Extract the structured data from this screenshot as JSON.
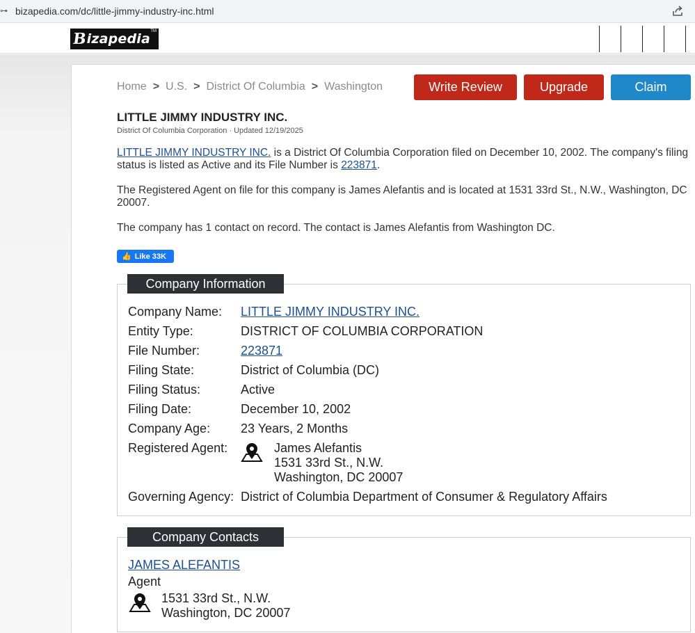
{
  "browser": {
    "url": "bizapedia.com/dc/little-jimmy-industry-inc.html",
    "site_icon": "⊶",
    "share_icon": "share-icon"
  },
  "header": {
    "logo_text": "Bizapedia",
    "logo_mark": "B",
    "logo_rest": "izapedia",
    "logo_tm": "TM"
  },
  "breadcrumb": {
    "items": [
      "Home",
      "U.S.",
      "District Of Columbia",
      "Washington"
    ],
    "separator": ">"
  },
  "actions": {
    "write_review": "Write Review",
    "upgrade": "Upgrade",
    "claim": "Claim"
  },
  "company": {
    "name": "LITTLE JIMMY INDUSTRY INC.",
    "subtitle": "District Of Columbia Corporation · Updated 12/19/2025"
  },
  "summary": {
    "p1_link": "LITTLE JIMMY INDUSTRY INC.",
    "p1_text": " is a District Of Columbia Corporation filed on December 10, 2002. The company's filing status is listed as Active and its File Number is ",
    "p1_file_link": "223871",
    "p1_end": ".",
    "p2": "The Registered Agent on file for this company is James Alefantis and is located at 1531 33rd St., N.W., Washington, DC 20007.",
    "p3": "The company has 1 contact on record. The contact is James Alefantis from Washington DC."
  },
  "like_button": {
    "label": "Like 33K",
    "icon": "👍"
  },
  "company_info": {
    "heading": "Company Information",
    "rows": [
      {
        "label": "Company Name:",
        "value": "LITTLE JIMMY INDUSTRY INC."
      },
      {
        "label": "Entity Type:",
        "value": "DISTRICT OF COLUMBIA CORPORATION"
      },
      {
        "label": "File Number:",
        "value": "223871"
      },
      {
        "label": "Filing State:",
        "value": "District of Columbia (DC)"
      },
      {
        "label": "Filing Status:",
        "value": "Active"
      },
      {
        "label": "Filing Date:",
        "value": "December 10, 2002"
      },
      {
        "label": "Company Age:",
        "value": "23 Years, 2 Months"
      },
      {
        "label": "Registered Agent:",
        "value_lines": [
          "James Alefantis",
          "1531 33rd St., N.W.",
          "Washington, DC 20007"
        ]
      },
      {
        "label": "Governing Agency:",
        "value": "District of Columbia Department of Consumer & Regulatory Affairs"
      }
    ]
  },
  "company_contacts": {
    "heading": "Company Contacts",
    "contacts": [
      {
        "name": "JAMES ALEFANTIS",
        "role": "Agent",
        "address_lines": [
          "1531 33rd St., N.W.",
          "Washington, DC 20007"
        ]
      }
    ]
  }
}
